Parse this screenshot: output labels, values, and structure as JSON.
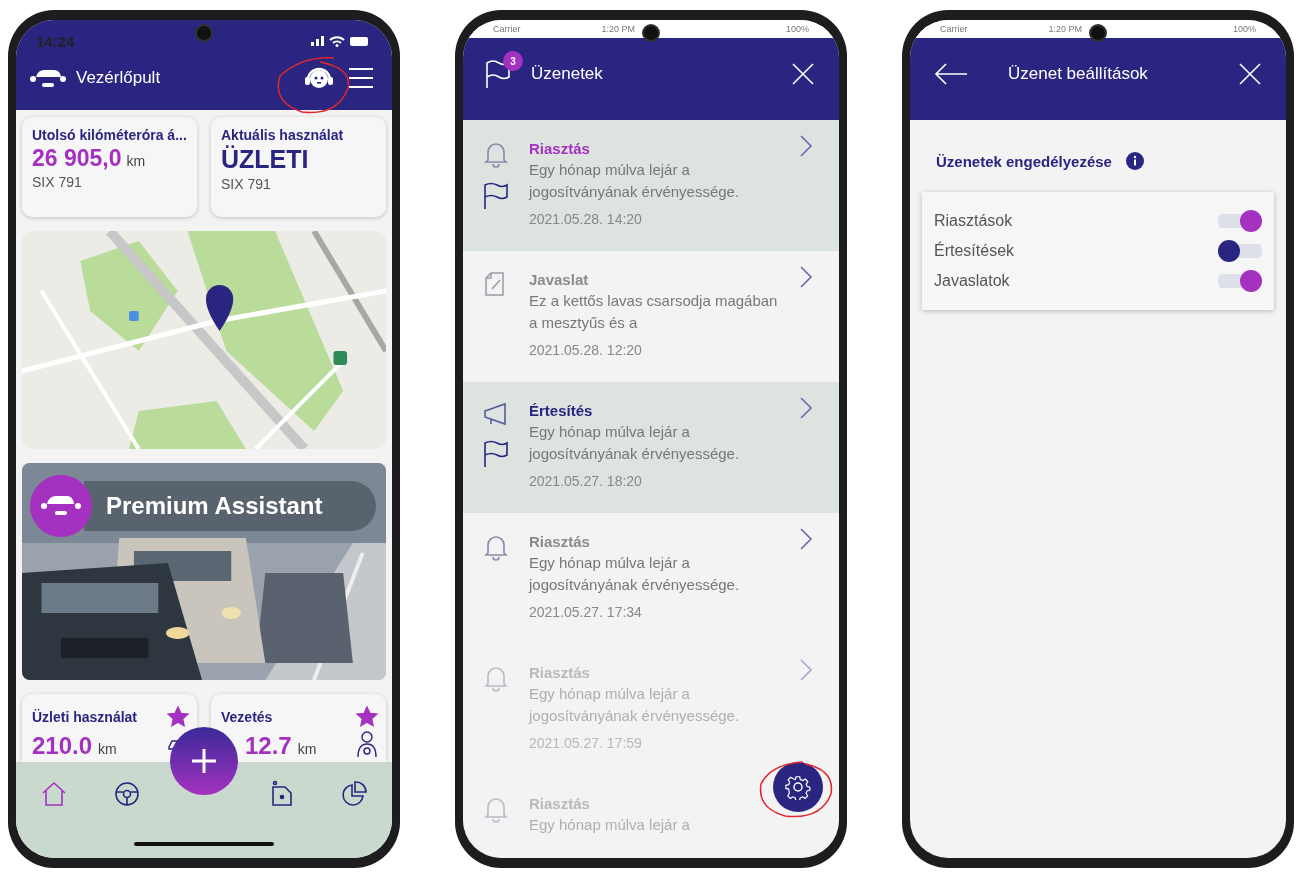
{
  "dashboard": {
    "status_bar": {
      "time": "14:24"
    },
    "title": "Vezérlőpult",
    "assistant_circled": true,
    "cards": [
      {
        "kind": "odometer",
        "label": "Utolsó kilóméteróra á...",
        "value": "26 905,0",
        "unit": "km",
        "plate": "SIX 791"
      },
      {
        "kind": "usage",
        "label": "Aktuális használat",
        "value": "ÜZLETI",
        "plate": "SIX 791"
      }
    ],
    "banner": {
      "title": "Premium Assistant"
    },
    "stats": [
      {
        "kind": "car",
        "label": "Üzleti használat",
        "value": "210.0",
        "unit": "km",
        "starred": true
      },
      {
        "kind": "driver",
        "label": "Vezetés",
        "value": "12.7",
        "unit": "km",
        "starred": true
      }
    ],
    "nav": [
      {
        "kind": "home",
        "selected": true
      },
      {
        "kind": "wheel",
        "selected": false
      },
      {
        "kind": "canister",
        "selected": false
      },
      {
        "kind": "chart",
        "selected": false
      }
    ]
  },
  "messages": {
    "status_bar": {
      "carrier": "Carrier",
      "time": "1:20 PM",
      "battery": "100%"
    },
    "title": "Üzenetek",
    "badge": "3",
    "settings_circled": true,
    "items": [
      {
        "kind": "alert",
        "unread": true,
        "faded": false,
        "title": "Riasztás",
        "body": "Egy hónap múlva lejár a jogosítványának érvényessége.",
        "date": "2021.05.28. 14:20"
      },
      {
        "kind": "suggestion",
        "unread": false,
        "faded": false,
        "title": "Javaslat",
        "body": "Ez a kettős lavas csarsodja magában a mesztyűs és a",
        "date": "2021.05.28. 12:20"
      },
      {
        "kind": "notice",
        "unread": true,
        "faded": false,
        "title": "Értesítés",
        "body": "Egy hónap múlva lejár a jogosítványának érvényessége.",
        "date": "2021.05.27. 18:20"
      },
      {
        "kind": "alert",
        "unread": false,
        "faded": false,
        "title": "Riasztás",
        "body": "Egy hónap múlva lejár a jogosítványának érvényessége.",
        "date": "2021.05.27. 17:34"
      },
      {
        "kind": "alert",
        "unread": false,
        "faded": true,
        "title": "Riasztás",
        "body": "Egy hónap múlva lejár a jogosítványának érvényessége.",
        "date": "2021.05.27. 17:59"
      },
      {
        "kind": "alert",
        "unread": false,
        "faded": true,
        "title": "Riasztás",
        "body": "Egy hónap múlva lejár a"
      }
    ]
  },
  "settings": {
    "status_bar": {
      "carrier": "Carrier",
      "time": "1:20 PM",
      "battery": "100%"
    },
    "title": "Üzenet beállítások",
    "section": "Üzenetek engedélyezése",
    "toggles": [
      {
        "label": "Riasztások",
        "on": true
      },
      {
        "label": "Értesítések",
        "on": false
      },
      {
        "label": "Javaslatok",
        "on": true
      }
    ]
  }
}
